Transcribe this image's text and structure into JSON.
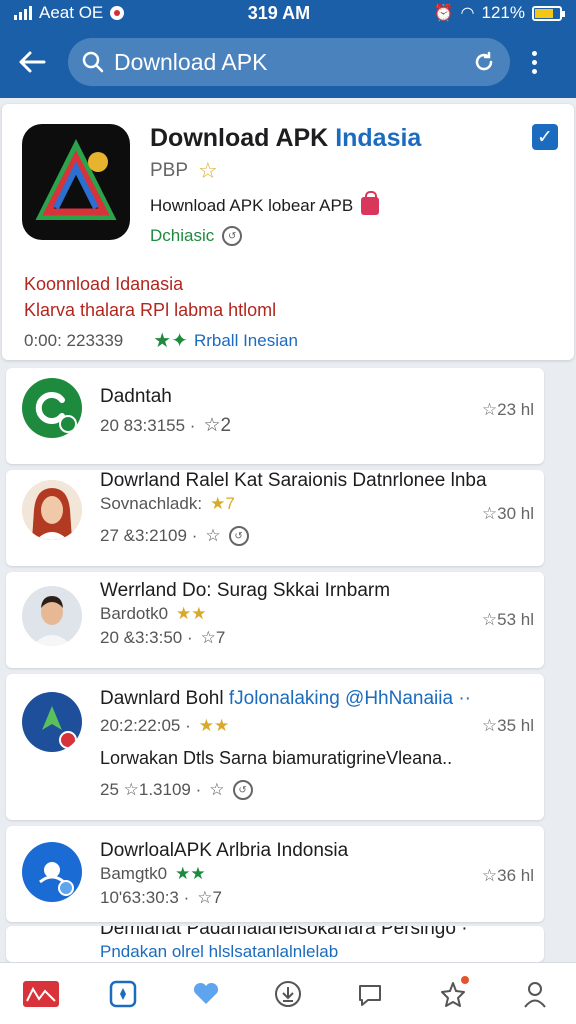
{
  "status_bar": {
    "carrier": "Aeat OE",
    "time": "319 AM",
    "battery": "121%"
  },
  "app_bar": {
    "search_value": "Download APK"
  },
  "featured": {
    "title_main": "Download APK ",
    "title_highlight": "Indasia",
    "rating_text": "PBP",
    "subtitle": "Hownload APK lobear APB",
    "status": "Dchiasic",
    "red_line_1": "Koonnload Idanasia",
    "red_line_2": "Klarva thalara RPl labma htloml",
    "footer_time": "0:00: 223339",
    "footer_link": "Rrball Inesian"
  },
  "items": [
    {
      "title": "Dadntah",
      "line1": "20 83:3155 ·",
      "line1_stars": "☆2",
      "right": "☆23 hl"
    },
    {
      "title": "Dowrland Ralel Kat Saraionis Datnrlonee lnba",
      "line1": "Sovnachladk:",
      "line1_stars": "★7",
      "line2": "27 &3:2109 ·",
      "line2_extra": "☆",
      "right": "☆30 hl"
    },
    {
      "title": "Werrland Do: Surag Skkai Irnbarm",
      "line1": "Bardotk0",
      "line1_stars": "★★",
      "line2": "20 &3:3:50 ·",
      "line2_extra": "☆7",
      "right": "☆53 hl"
    },
    {
      "title": "Dawnlard Bohl ",
      "title_link": "fJolonalaking @HhNanaiia ··",
      "line1": "20:2:22:05 ·",
      "line1_stars": "★★",
      "line2": "Lorwakan Dtls Sarna biamuratigrineVleana..",
      "line3": "25 ☆1.3109 ·",
      "line3_extra": "☆",
      "right": "☆35 hl"
    },
    {
      "title": "DowrloalAPK Arlbria Indonsia",
      "line1": "Bamgtk0",
      "line1_stars": "★★",
      "line2": "10'63:30:3 ·",
      "line2_extra": "☆7",
      "right": "☆36 hl"
    },
    {
      "title": "Demlanat Padamalanelsokanara Persingo ·",
      "line1": "Pndakan olrel hlslsatanlalnlelab"
    }
  ],
  "icons": {
    "back": "arrow-left-icon",
    "search": "search-icon",
    "refresh": "refresh-icon",
    "more": "more-vertical-icon"
  },
  "colors": {
    "primary": "#1b5fa8",
    "accent": "#1b6bbf",
    "green": "#1e8a3e",
    "red": "#b3261e"
  }
}
